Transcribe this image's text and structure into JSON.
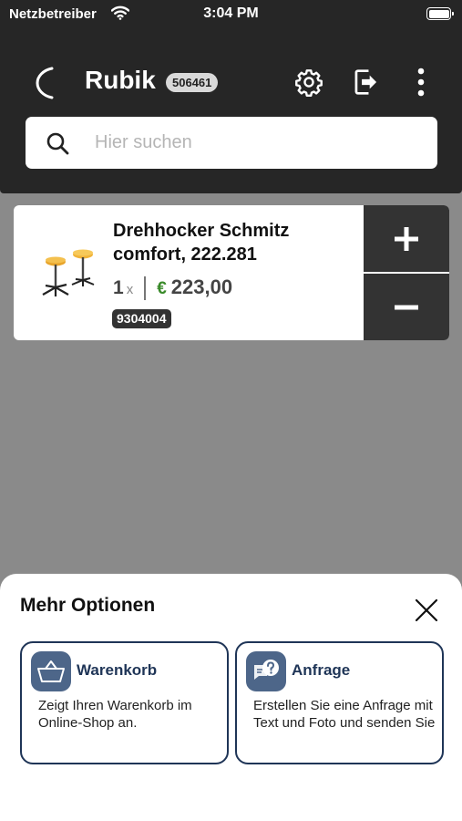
{
  "status_bar": {
    "carrier": "Netzbetreiber",
    "time": "3:04 PM",
    "wifi_icon": "wifi-icon",
    "battery_icon": "battery-icon"
  },
  "header": {
    "logo_icon": "moon-logo-icon",
    "title": "Rubik",
    "user_id": "506461",
    "actions": [
      "gear-icon",
      "logout-icon",
      "more-vertical-icon"
    ]
  },
  "search": {
    "placeholder": "Hier suchen",
    "value": "",
    "icon": "search-icon"
  },
  "product": {
    "name": "Drehhocker Schmitz comfort, 222.281",
    "quantity": "1",
    "quantity_suffix": "x",
    "currency": "€",
    "price": "223,00",
    "sku": "9304004",
    "plus_icon": "plus-icon",
    "minus_icon": "minus-icon"
  },
  "sheet": {
    "title": "Mehr Optionen",
    "close_icon": "close-icon",
    "options": [
      {
        "icon": "basket-icon",
        "title": "Warenkorb",
        "description": "Zeigt Ihren Warenkorb im Online-Shop an."
      },
      {
        "icon": "chat-question-icon",
        "title": "Anfrage",
        "description": "Erstellen Sie eine Anfrage mit Text und Foto und senden Sie"
      }
    ]
  },
  "colors": {
    "header_bg": "#262626",
    "overlay_bg": "#8a8a8a",
    "accent_navy": "#1f3557",
    "icon_tile": "#4d6689",
    "price_green": "#3a8a2a",
    "qty_button_bg": "#333333"
  }
}
